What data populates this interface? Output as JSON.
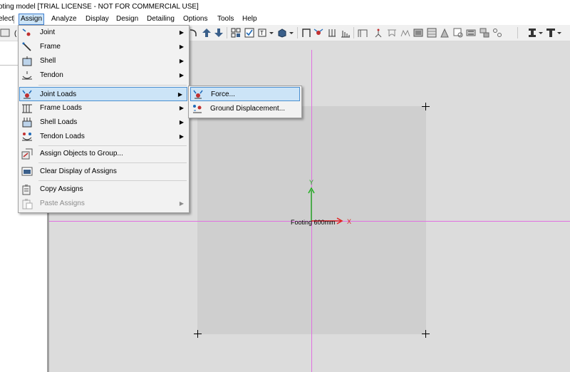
{
  "window": {
    "title": "oting model  [TRIAL LICENSE - NOT FOR COMMERCIAL USE]"
  },
  "menubar": {
    "items": [
      {
        "label": "elect"
      },
      {
        "label": "Assign"
      },
      {
        "label": "Analyze"
      },
      {
        "label": "Display"
      },
      {
        "label": "Design"
      },
      {
        "label": "Detailing"
      },
      {
        "label": "Options"
      },
      {
        "label": "Tools"
      },
      {
        "label": "Help"
      }
    ]
  },
  "assign_menu": {
    "items": [
      {
        "label": "Joint",
        "icon": "joint-icon",
        "submenu": true
      },
      {
        "label": "Frame",
        "icon": "frame-icon",
        "submenu": true
      },
      {
        "label": "Shell",
        "icon": "shell-icon",
        "submenu": true
      },
      {
        "label": "Tendon",
        "icon": "tendon-icon",
        "submenu": true
      },
      {
        "label": "Joint Loads",
        "icon": "joint-loads-icon",
        "submenu": true,
        "highlighted": true
      },
      {
        "label": "Frame Loads",
        "icon": "frame-loads-icon",
        "submenu": true
      },
      {
        "label": "Shell Loads",
        "icon": "shell-loads-icon",
        "submenu": true
      },
      {
        "label": "Tendon Loads",
        "icon": "tendon-loads-icon",
        "submenu": true
      },
      {
        "label": "Assign Objects to Group...",
        "icon": "assign-group-icon",
        "submenu": false
      },
      {
        "label": "Clear Display of Assigns",
        "icon": "clear-display-icon",
        "submenu": false
      },
      {
        "label": "Copy Assigns",
        "icon": "copy-assigns-icon",
        "submenu": false
      },
      {
        "label": "Paste Assigns",
        "icon": "paste-assigns-icon",
        "submenu": true,
        "disabled": true
      }
    ]
  },
  "joint_loads_submenu": {
    "items": [
      {
        "label": "Force...",
        "icon": "force-icon",
        "highlighted": true
      },
      {
        "label": "Ground Displacement...",
        "icon": "ground-displacement-icon"
      }
    ]
  },
  "canvas": {
    "object_label": "Footing 600mm",
    "x_axis_label": "X",
    "y_axis_label": "Y"
  },
  "colors": {
    "accent": "#cce4f7",
    "accent_border": "#4a8fd0",
    "grid_line": "#e070e0",
    "x_axis": "#e02020",
    "y_axis": "#20b020"
  }
}
